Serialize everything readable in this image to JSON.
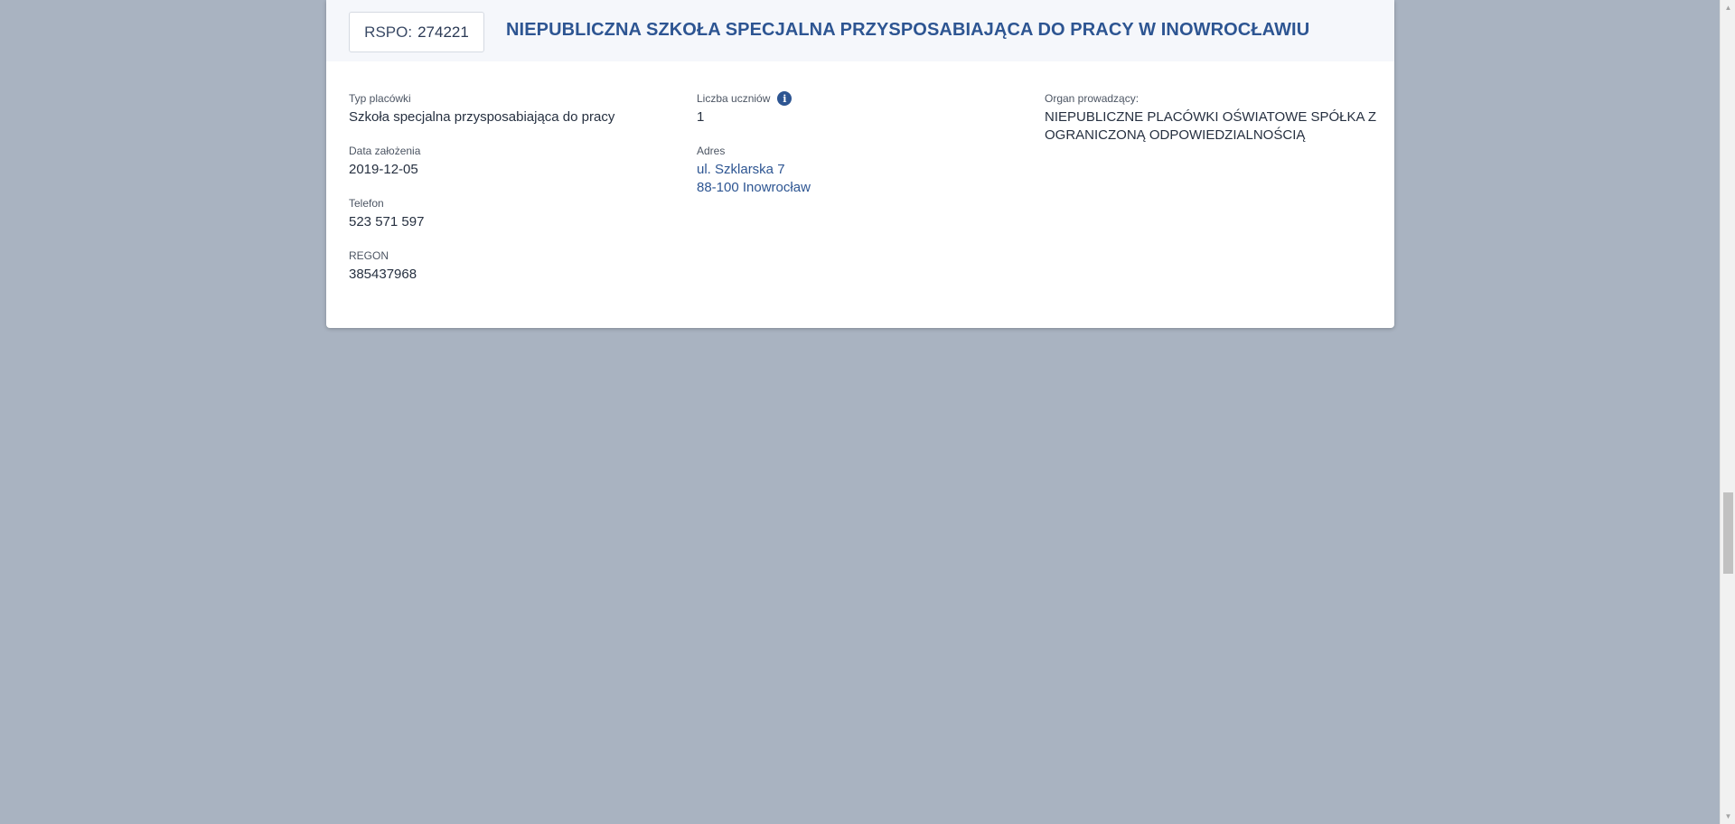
{
  "school": {
    "rspo_prefix": "RSPO:",
    "rspo_number": "274221",
    "name": "NIEPUBLICZNA SZKOŁA SPECJALNA PRZYSPOSABIAJĄCA DO PRACY W INOWROCŁAWIU"
  },
  "fields": {
    "type": {
      "label": "Typ placówki",
      "value": "Szkoła specjalna przysposabiająca do pracy"
    },
    "founded": {
      "label": "Data założenia",
      "value": "2019-12-05"
    },
    "phone": {
      "label": "Telefon",
      "value": "523 571 597"
    },
    "regon": {
      "label": "REGON",
      "value": "385437968"
    },
    "students": {
      "label": "Liczba uczniów",
      "value": "1",
      "icon": "info-icon"
    },
    "address": {
      "label": "Adres",
      "line1": "ul. Szklarska 7",
      "line2": "88-100 Inowrocław"
    },
    "governing_body": {
      "label": "Organ prowadzący:",
      "value": "NIEPUBLICZNE PLACÓWKI OŚWIATOWE SPÓŁKA Z OGRANICZONĄ ODPOWIEDZIALNOŚCIĄ"
    }
  },
  "colors": {
    "background": "#a9b3c1",
    "accent": "#2d5592",
    "card": "#ffffff",
    "header": "#f5f7fb"
  },
  "icons": {
    "info": "i",
    "scroll_up": "▲",
    "scroll_down": "▼"
  }
}
